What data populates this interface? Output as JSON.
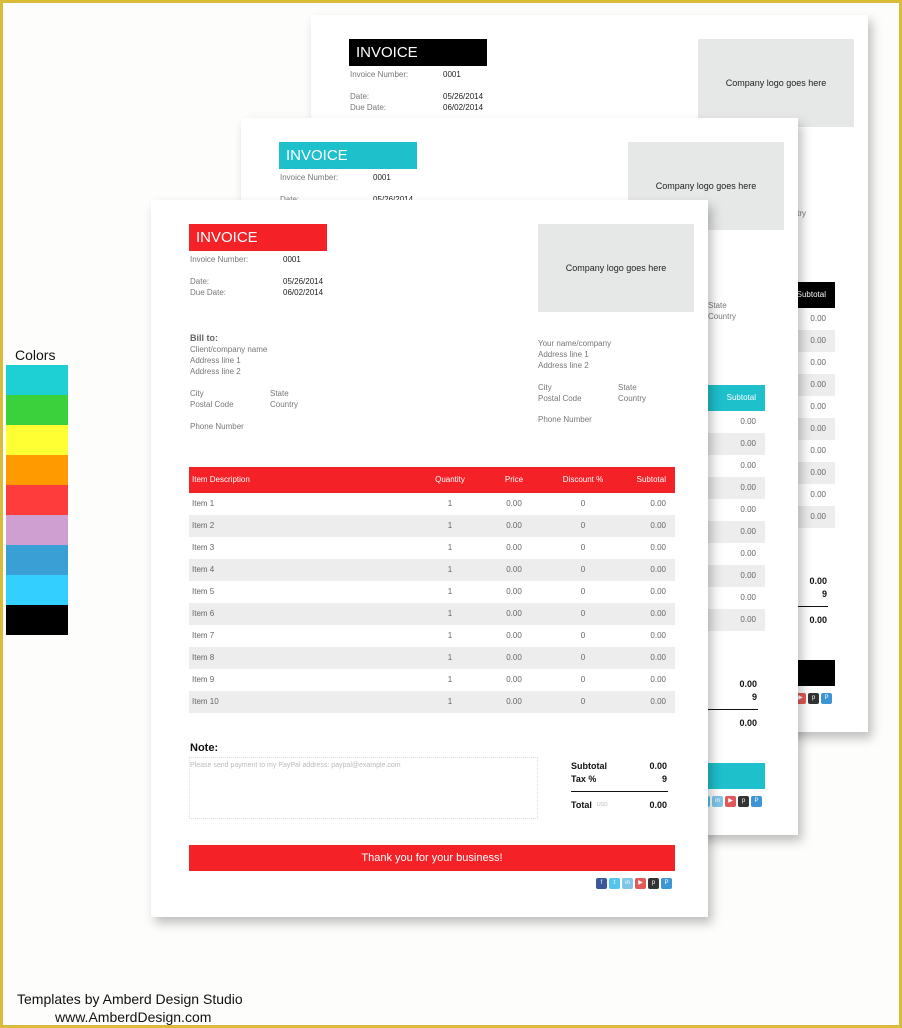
{
  "invoice": {
    "title": "INVOICE",
    "invoice_number_label": "Invoice Number:",
    "invoice_number": "0001",
    "date_label": "Date:",
    "date": "05/26/2014",
    "due_date_label": "Due Date:",
    "due_date": "06/02/2014",
    "logo_placeholder": "Company logo goes here",
    "bill_to": {
      "heading": "Bill to:",
      "lines": [
        "Client/company name",
        "Address line 1",
        "Address line 2"
      ],
      "city": "City",
      "state": "State",
      "postal": "Postal Code",
      "country": "Country",
      "phone": "Phone Number"
    },
    "sender": {
      "lines": [
        "Your name/company",
        "Address line 1",
        "Address line 2"
      ],
      "city": "City",
      "state": "State",
      "postal": "Postal Code",
      "country": "Country",
      "phone": "Phone Number"
    },
    "table": {
      "headers": [
        "Item Description",
        "Quantity",
        "Price",
        "Discount %",
        "Subtotal"
      ],
      "rows": [
        [
          "Item 1",
          "1",
          "0.00",
          "0",
          "0.00"
        ],
        [
          "Item 2",
          "1",
          "0.00",
          "0",
          "0.00"
        ],
        [
          "Item 3",
          "1",
          "0.00",
          "0",
          "0.00"
        ],
        [
          "Item 4",
          "1",
          "0.00",
          "0",
          "0.00"
        ],
        [
          "Item 5",
          "1",
          "0.00",
          "0",
          "0.00"
        ],
        [
          "Item 6",
          "1",
          "0.00",
          "0",
          "0.00"
        ],
        [
          "Item 7",
          "1",
          "0.00",
          "0",
          "0.00"
        ],
        [
          "Item 8",
          "1",
          "0.00",
          "0",
          "0.00"
        ],
        [
          "Item 9",
          "1",
          "0.00",
          "0",
          "0.00"
        ],
        [
          "Item 10",
          "1",
          "0.00",
          "0",
          "0.00"
        ]
      ]
    },
    "note_title": "Note:",
    "note_text": "Please send payment to my PayPal address: paypal@example.com",
    "subtotal_label": "Subtotal",
    "subtotal": "0.00",
    "tax_label": "Tax %",
    "tax": "9",
    "total_label": "Total",
    "total_currency": "USD",
    "total": "0.00",
    "thanks": "Thank you for your business!",
    "social_icons": [
      {
        "name": "facebook-icon",
        "glyph": "f",
        "color": "#3b5998"
      },
      {
        "name": "twitter-icon",
        "glyph": "t",
        "color": "#55c5ef"
      },
      {
        "name": "linkedin-icon",
        "glyph": "in",
        "color": "#7fc6e8"
      },
      {
        "name": "youtube-icon",
        "glyph": "▶",
        "color": "#e05a5a"
      },
      {
        "name": "pinterest-icon",
        "glyph": "p",
        "color": "#333333"
      },
      {
        "name": "paypal-icon",
        "glyph": "P",
        "color": "#3d95d6"
      }
    ]
  },
  "templates": [
    {
      "name": "black",
      "accent": "#000000"
    },
    {
      "name": "cyan",
      "accent": "#1ec0cc"
    },
    {
      "name": "red",
      "accent": "#f42127"
    }
  ],
  "colors": {
    "title": "Colors",
    "swatches": [
      "#1ed0d4",
      "#3ad13c",
      "#ffff33",
      "#ff9b00",
      "#ff3c3c",
      "#cf9fd1",
      "#3a9fd4",
      "#33d0ff",
      "#000000"
    ]
  },
  "credits": {
    "line1": "Templates by Amberd Design Studio",
    "line2": "www.AmberdDesign.com"
  }
}
